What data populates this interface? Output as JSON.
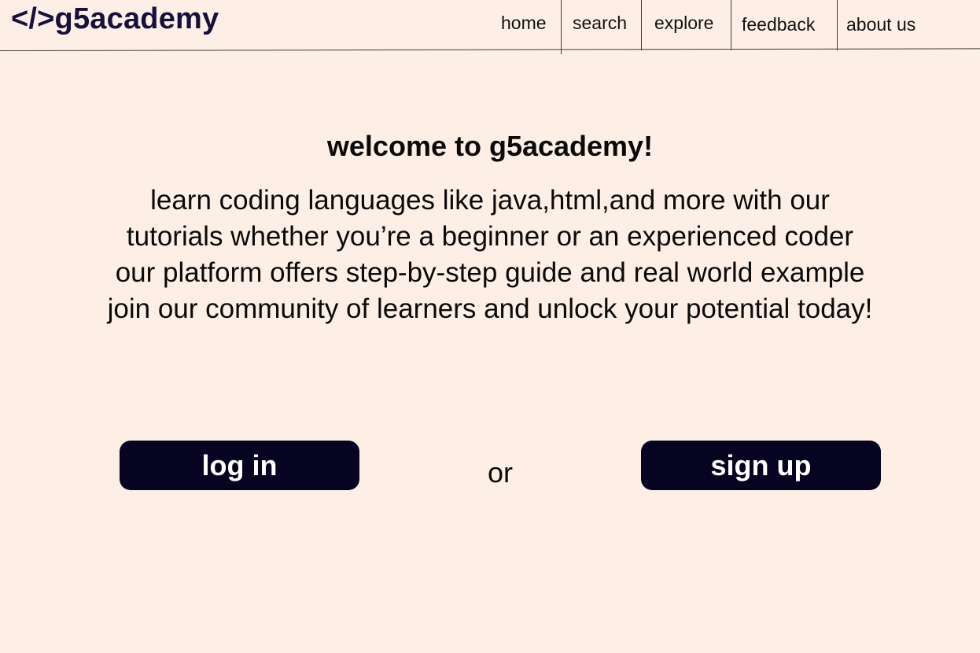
{
  "header": {
    "logo": "</>g5academy",
    "nav": [
      {
        "label": "home"
      },
      {
        "label": "search"
      },
      {
        "label": "explore"
      },
      {
        "label": "feedback"
      },
      {
        "label": "about us"
      }
    ]
  },
  "main": {
    "title": "welcome to g5academy!",
    "intro_lines": [
      "learn coding languages like java,html,and more with our",
      "tutorials whether you’re a beginner or an experienced coder",
      "our platform offers step-by-step guide and real world example",
      "join our community of learners and unlock your potential today!"
    ],
    "login_label": "log in",
    "or_label": "or",
    "signup_label": "sign up"
  },
  "colors": {
    "background": "#fdefe5",
    "logo": "#16103d",
    "button": "#070421",
    "button_text": "#ffffff"
  }
}
